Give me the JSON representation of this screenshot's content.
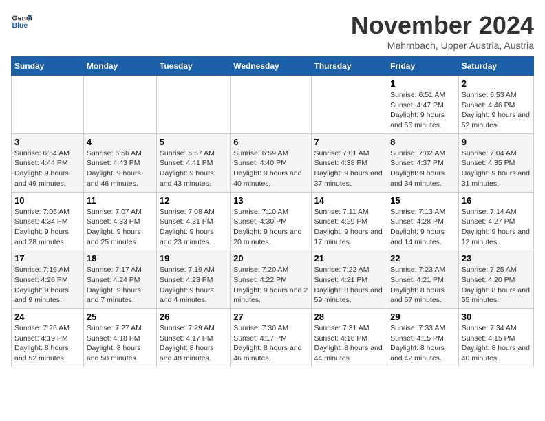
{
  "header": {
    "logo_line1": "General",
    "logo_line2": "Blue",
    "month_title": "November 2024",
    "subtitle": "Mehrnbach, Upper Austria, Austria"
  },
  "weekdays": [
    "Sunday",
    "Monday",
    "Tuesday",
    "Wednesday",
    "Thursday",
    "Friday",
    "Saturday"
  ],
  "weeks": [
    [
      {
        "day": "",
        "sunrise": "",
        "sunset": "",
        "daylight": ""
      },
      {
        "day": "",
        "sunrise": "",
        "sunset": "",
        "daylight": ""
      },
      {
        "day": "",
        "sunrise": "",
        "sunset": "",
        "daylight": ""
      },
      {
        "day": "",
        "sunrise": "",
        "sunset": "",
        "daylight": ""
      },
      {
        "day": "",
        "sunrise": "",
        "sunset": "",
        "daylight": ""
      },
      {
        "day": "1",
        "sunrise": "Sunrise: 6:51 AM",
        "sunset": "Sunset: 4:47 PM",
        "daylight": "Daylight: 9 hours and 56 minutes."
      },
      {
        "day": "2",
        "sunrise": "Sunrise: 6:53 AM",
        "sunset": "Sunset: 4:46 PM",
        "daylight": "Daylight: 9 hours and 52 minutes."
      }
    ],
    [
      {
        "day": "3",
        "sunrise": "Sunrise: 6:54 AM",
        "sunset": "Sunset: 4:44 PM",
        "daylight": "Daylight: 9 hours and 49 minutes."
      },
      {
        "day": "4",
        "sunrise": "Sunrise: 6:56 AM",
        "sunset": "Sunset: 4:43 PM",
        "daylight": "Daylight: 9 hours and 46 minutes."
      },
      {
        "day": "5",
        "sunrise": "Sunrise: 6:57 AM",
        "sunset": "Sunset: 4:41 PM",
        "daylight": "Daylight: 9 hours and 43 minutes."
      },
      {
        "day": "6",
        "sunrise": "Sunrise: 6:59 AM",
        "sunset": "Sunset: 4:40 PM",
        "daylight": "Daylight: 9 hours and 40 minutes."
      },
      {
        "day": "7",
        "sunrise": "Sunrise: 7:01 AM",
        "sunset": "Sunset: 4:38 PM",
        "daylight": "Daylight: 9 hours and 37 minutes."
      },
      {
        "day": "8",
        "sunrise": "Sunrise: 7:02 AM",
        "sunset": "Sunset: 4:37 PM",
        "daylight": "Daylight: 9 hours and 34 minutes."
      },
      {
        "day": "9",
        "sunrise": "Sunrise: 7:04 AM",
        "sunset": "Sunset: 4:35 PM",
        "daylight": "Daylight: 9 hours and 31 minutes."
      }
    ],
    [
      {
        "day": "10",
        "sunrise": "Sunrise: 7:05 AM",
        "sunset": "Sunset: 4:34 PM",
        "daylight": "Daylight: 9 hours and 28 minutes."
      },
      {
        "day": "11",
        "sunrise": "Sunrise: 7:07 AM",
        "sunset": "Sunset: 4:33 PM",
        "daylight": "Daylight: 9 hours and 25 minutes."
      },
      {
        "day": "12",
        "sunrise": "Sunrise: 7:08 AM",
        "sunset": "Sunset: 4:31 PM",
        "daylight": "Daylight: 9 hours and 23 minutes."
      },
      {
        "day": "13",
        "sunrise": "Sunrise: 7:10 AM",
        "sunset": "Sunset: 4:30 PM",
        "daylight": "Daylight: 9 hours and 20 minutes."
      },
      {
        "day": "14",
        "sunrise": "Sunrise: 7:11 AM",
        "sunset": "Sunset: 4:29 PM",
        "daylight": "Daylight: 9 hours and 17 minutes."
      },
      {
        "day": "15",
        "sunrise": "Sunrise: 7:13 AM",
        "sunset": "Sunset: 4:28 PM",
        "daylight": "Daylight: 9 hours and 14 minutes."
      },
      {
        "day": "16",
        "sunrise": "Sunrise: 7:14 AM",
        "sunset": "Sunset: 4:27 PM",
        "daylight": "Daylight: 9 hours and 12 minutes."
      }
    ],
    [
      {
        "day": "17",
        "sunrise": "Sunrise: 7:16 AM",
        "sunset": "Sunset: 4:26 PM",
        "daylight": "Daylight: 9 hours and 9 minutes."
      },
      {
        "day": "18",
        "sunrise": "Sunrise: 7:17 AM",
        "sunset": "Sunset: 4:24 PM",
        "daylight": "Daylight: 9 hours and 7 minutes."
      },
      {
        "day": "19",
        "sunrise": "Sunrise: 7:19 AM",
        "sunset": "Sunset: 4:23 PM",
        "daylight": "Daylight: 9 hours and 4 minutes."
      },
      {
        "day": "20",
        "sunrise": "Sunrise: 7:20 AM",
        "sunset": "Sunset: 4:22 PM",
        "daylight": "Daylight: 9 hours and 2 minutes."
      },
      {
        "day": "21",
        "sunrise": "Sunrise: 7:22 AM",
        "sunset": "Sunset: 4:21 PM",
        "daylight": "Daylight: 8 hours and 59 minutes."
      },
      {
        "day": "22",
        "sunrise": "Sunrise: 7:23 AM",
        "sunset": "Sunset: 4:21 PM",
        "daylight": "Daylight: 8 hours and 57 minutes."
      },
      {
        "day": "23",
        "sunrise": "Sunrise: 7:25 AM",
        "sunset": "Sunset: 4:20 PM",
        "daylight": "Daylight: 8 hours and 55 minutes."
      }
    ],
    [
      {
        "day": "24",
        "sunrise": "Sunrise: 7:26 AM",
        "sunset": "Sunset: 4:19 PM",
        "daylight": "Daylight: 8 hours and 52 minutes."
      },
      {
        "day": "25",
        "sunrise": "Sunrise: 7:27 AM",
        "sunset": "Sunset: 4:18 PM",
        "daylight": "Daylight: 8 hours and 50 minutes."
      },
      {
        "day": "26",
        "sunrise": "Sunrise: 7:29 AM",
        "sunset": "Sunset: 4:17 PM",
        "daylight": "Daylight: 8 hours and 48 minutes."
      },
      {
        "day": "27",
        "sunrise": "Sunrise: 7:30 AM",
        "sunset": "Sunset: 4:17 PM",
        "daylight": "Daylight: 8 hours and 46 minutes."
      },
      {
        "day": "28",
        "sunrise": "Sunrise: 7:31 AM",
        "sunset": "Sunset: 4:16 PM",
        "daylight": "Daylight: 8 hours and 44 minutes."
      },
      {
        "day": "29",
        "sunrise": "Sunrise: 7:33 AM",
        "sunset": "Sunset: 4:15 PM",
        "daylight": "Daylight: 8 hours and 42 minutes."
      },
      {
        "day": "30",
        "sunrise": "Sunrise: 7:34 AM",
        "sunset": "Sunset: 4:15 PM",
        "daylight": "Daylight: 8 hours and 40 minutes."
      }
    ]
  ]
}
